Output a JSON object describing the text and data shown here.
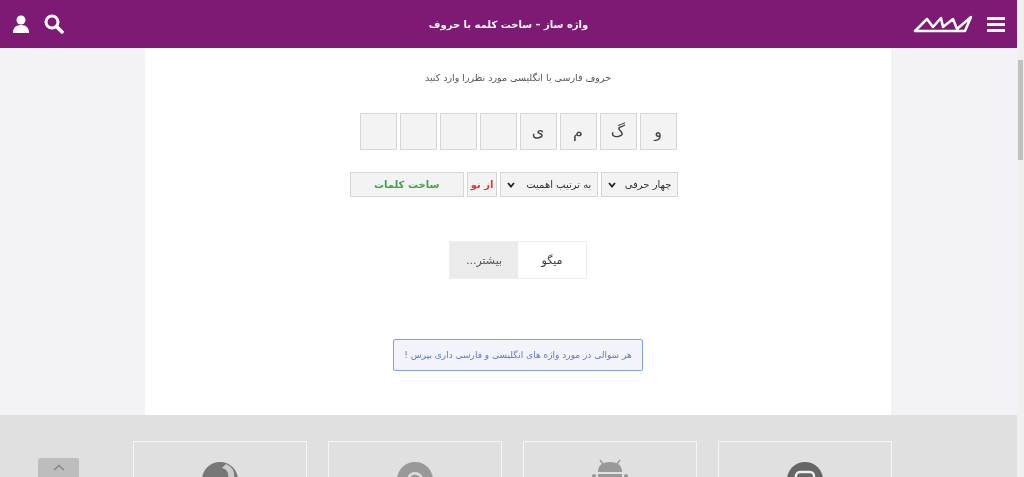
{
  "header": {
    "title": "واژه ساز – ساخت کلمه با حروف"
  },
  "form": {
    "prompt": "حروف فارسی یا انگلیسی مورد نظررا وارد کنید",
    "letters": [
      {
        "kind": "filled",
        "value": "و"
      },
      {
        "kind": "filled",
        "value": "گ"
      },
      {
        "kind": "filled",
        "value": "م"
      },
      {
        "kind": "filled",
        "value": "ی"
      },
      {
        "kind": "empty"
      },
      {
        "kind": "empty"
      },
      {
        "kind": "empty"
      },
      {
        "kind": "empty"
      }
    ],
    "length_select": {
      "value": "چهار حرفی"
    },
    "order_select": {
      "value": "به ترتیب اهمیت"
    },
    "reset_button": "از نو",
    "build_button": "ساخت کلمات"
  },
  "tabs": [
    {
      "label": "میگو",
      "selected": true
    },
    {
      "label": "بیشتر...",
      "selected": false
    }
  ],
  "notice": "هر سوالی در مورد واژه های انگلیسی و فارسی داری بپرس !",
  "footer": {
    "cards": [
      {
        "kind": "firefox"
      },
      {
        "kind": "chrome"
      },
      {
        "kind": "android"
      },
      {
        "kind": "circle"
      }
    ]
  }
}
